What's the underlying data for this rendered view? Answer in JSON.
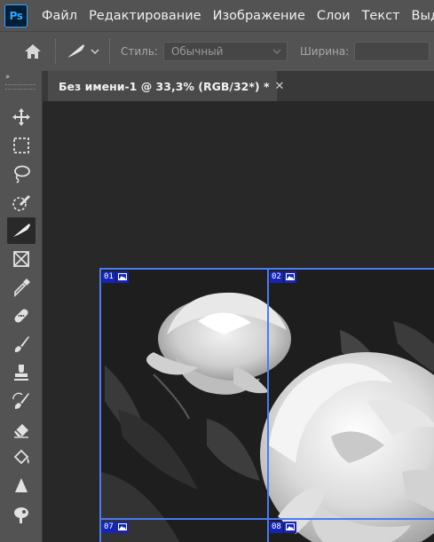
{
  "app": {
    "logo_text": "Ps"
  },
  "menu": {
    "items": [
      {
        "label": "Файл"
      },
      {
        "label": "Редактирование"
      },
      {
        "label": "Изображение"
      },
      {
        "label": "Слои"
      },
      {
        "label": "Текст"
      },
      {
        "label": "Выд"
      }
    ]
  },
  "options": {
    "style_label": "Стиль:",
    "style_value": "Обычный",
    "width_label": "Ширина:",
    "width_value": ""
  },
  "toolbar": {
    "collapse_glyph": "››",
    "tools": [
      {
        "name": "move-tool",
        "icon": "move-icon"
      },
      {
        "name": "marquee-tool",
        "icon": "rect-marquee-icon"
      },
      {
        "name": "lasso-tool",
        "icon": "lasso-icon"
      },
      {
        "name": "quick-selection-tool",
        "icon": "quick-select-icon"
      },
      {
        "name": "slice-tool",
        "icon": "slice-knife-icon",
        "active": true
      },
      {
        "name": "frame-tool",
        "icon": "frame-icon"
      },
      {
        "name": "eyedropper-tool",
        "icon": "eyedropper-icon"
      },
      {
        "name": "healing-brush-tool",
        "icon": "bandage-icon"
      },
      {
        "name": "brush-tool",
        "icon": "brush-icon"
      },
      {
        "name": "clone-stamp-tool",
        "icon": "stamp-icon"
      },
      {
        "name": "history-brush-tool",
        "icon": "history-brush-icon"
      },
      {
        "name": "eraser-tool",
        "icon": "eraser-icon"
      },
      {
        "name": "paint-bucket-tool",
        "icon": "bucket-icon"
      },
      {
        "name": "blur-tool",
        "icon": "blur-drop-icon"
      },
      {
        "name": "dodge-tool",
        "icon": "dodge-icon"
      }
    ]
  },
  "document": {
    "tab_title": "Без имени-1 @ 33,3% (RGB/32*) *",
    "close_glyph": "✕",
    "slices": [
      {
        "label": "01"
      },
      {
        "label": "02"
      },
      {
        "label": "07"
      },
      {
        "label": "08"
      }
    ]
  },
  "colors": {
    "chrome": "#535353",
    "canvas": "#282828",
    "slice_line": "#4a7bf5",
    "slice_label_bg": "#1524b8",
    "ps_blue": "#31a8ff"
  }
}
